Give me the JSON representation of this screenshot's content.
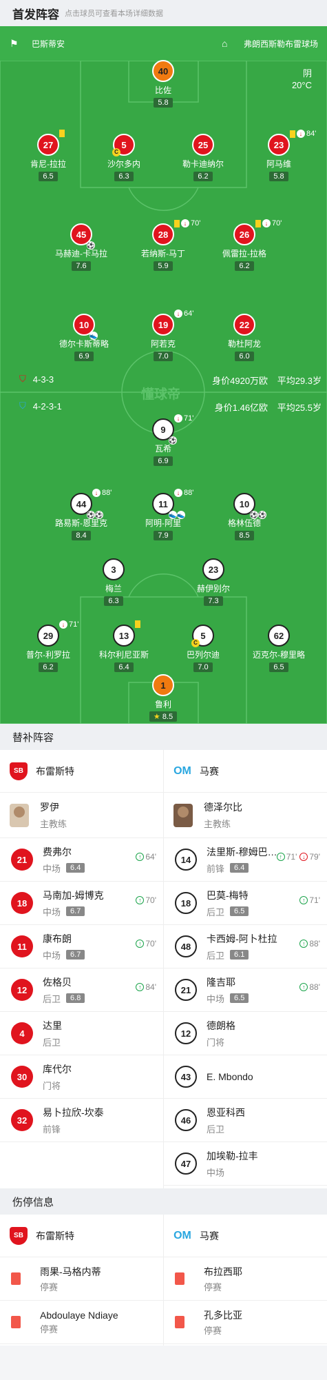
{
  "header": {
    "title": "首发阵容",
    "subtitle": "点击球员可查看本场详细数据"
  },
  "venue": {
    "referee": "巴斯蒂安",
    "stadium": "弗朗西斯勒布雷球场"
  },
  "weather": {
    "condition": "阴",
    "temp": "20°C"
  },
  "watermark": "懂球帝",
  "home_players": [
    {
      "num": "40",
      "name": "比佐",
      "rating": "5.8",
      "type": "gk"
    },
    {
      "num": "27",
      "name": "肯尼-拉拉",
      "rating": "6.5",
      "yellow": true
    },
    {
      "num": "5",
      "name": "沙尔多内",
      "rating": "6.3",
      "captain": true
    },
    {
      "num": "25",
      "name": "勒卡迪纳尔",
      "rating": "6.2"
    },
    {
      "num": "23",
      "name": "阿马维",
      "rating": "5.8",
      "yellow": true,
      "out": "84'"
    },
    {
      "num": "45",
      "name": "马赫迪-卡马拉",
      "rating": "7.6",
      "goals": 1
    },
    {
      "num": "28",
      "name": "若纳斯-马丁",
      "rating": "5.9",
      "yellow": true,
      "out": "70'"
    },
    {
      "num": "26",
      "name": "佩雷拉-拉格",
      "rating": "6.2",
      "yellow": true,
      "out": "70'"
    },
    {
      "num": "10",
      "name": "德尔卡斯蒂略",
      "rating": "6.9",
      "assists": 1
    },
    {
      "num": "19",
      "name": "阿若克",
      "rating": "7.0",
      "out": "64'"
    },
    {
      "num": "22",
      "name": "勒杜阿龙",
      "rating": "6.0"
    }
  ],
  "home_formation": {
    "formation": "4-3-3",
    "value": "身价4920万欧",
    "avg_age": "平均29.3岁"
  },
  "away_formation": {
    "formation": "4-2-3-1",
    "value": "身价1.46亿欧",
    "avg_age": "平均25.5岁"
  },
  "away_players": [
    {
      "num": "9",
      "name": "瓦希",
      "rating": "6.9",
      "out": "71'",
      "goals": 1
    },
    {
      "num": "44",
      "name": "路易斯-恩里克",
      "rating": "8.4",
      "out": "88'",
      "goals": 2
    },
    {
      "num": "11",
      "name": "阿明-阿里",
      "rating": "7.9",
      "out": "88'",
      "assists": 2
    },
    {
      "num": "10",
      "name": "格林伍德",
      "rating": "8.5",
      "goals": 2
    },
    {
      "num": "3",
      "name": "梅兰",
      "rating": "6.3"
    },
    {
      "num": "23",
      "name": "赫伊别尔",
      "rating": "7.3"
    },
    {
      "num": "29",
      "name": "普尔-利罗拉",
      "rating": "6.2",
      "out": "71'"
    },
    {
      "num": "13",
      "name": "科尔利尼亚斯",
      "rating": "6.4",
      "yellow": true
    },
    {
      "num": "5",
      "name": "巴列尔迪",
      "rating": "7.0",
      "captain": true
    },
    {
      "num": "62",
      "name": "迈克尔-穆里略",
      "rating": "6.5"
    },
    {
      "num": "1",
      "name": "鲁利",
      "rating": "8.5",
      "type": "gk",
      "star": true
    }
  ],
  "subs_title": "替补阵容",
  "home_team": "布雷斯特",
  "away_team": "马赛",
  "home_coach": {
    "name": "罗伊",
    "role": "主教练"
  },
  "away_coach": {
    "name": "德泽尔比",
    "role": "主教练"
  },
  "home_subs": [
    {
      "num": "21",
      "name": "费弗尔",
      "pos": "中场",
      "rating": "6.4",
      "in": "64'"
    },
    {
      "num": "18",
      "name": "马南加-姆博克",
      "pos": "中场",
      "rating": "6.7",
      "in": "70'"
    },
    {
      "num": "11",
      "name": "康布朗",
      "pos": "中场",
      "rating": "6.7",
      "in": "70'"
    },
    {
      "num": "12",
      "name": "佐格贝",
      "pos": "后卫",
      "rating": "6.8",
      "in": "84'"
    },
    {
      "num": "4",
      "name": "达里",
      "pos": "后卫"
    },
    {
      "num": "30",
      "name": "库代尔",
      "pos": "门将"
    },
    {
      "num": "32",
      "name": "易卜拉欣-坎泰",
      "pos": "前锋"
    }
  ],
  "away_subs": [
    {
      "num": "14",
      "name": "法里斯-穆姆巴尼亚",
      "pos": "前锋",
      "rating": "6.4",
      "in": "71'",
      "out": "79'"
    },
    {
      "num": "18",
      "name": "巴莫-梅特",
      "pos": "后卫",
      "rating": "6.5",
      "in": "71'"
    },
    {
      "num": "48",
      "name": "卡西姆-阿卜杜拉",
      "pos": "后卫",
      "rating": "6.1",
      "in": "88'"
    },
    {
      "num": "21",
      "name": "隆吉耶",
      "pos": "中场",
      "rating": "6.5",
      "in": "88'"
    },
    {
      "num": "12",
      "name": "德朗格",
      "pos": "门将"
    },
    {
      "num": "43",
      "name": "E. Mbondo",
      "pos": ""
    },
    {
      "num": "46",
      "name": "恩亚科西",
      "pos": "后卫"
    },
    {
      "num": "47",
      "name": "加埃勒-拉丰",
      "pos": "中场"
    }
  ],
  "injury_title": "伤停信息",
  "home_injuries": [
    {
      "name": "雨果-马格内蒂",
      "status": "停赛"
    },
    {
      "name": "Abdoulaye Ndiaye",
      "status": "停赛"
    }
  ],
  "away_injuries": [
    {
      "name": "布拉西耶",
      "status": "停赛"
    },
    {
      "name": "孔多比亚",
      "status": "停赛"
    }
  ]
}
